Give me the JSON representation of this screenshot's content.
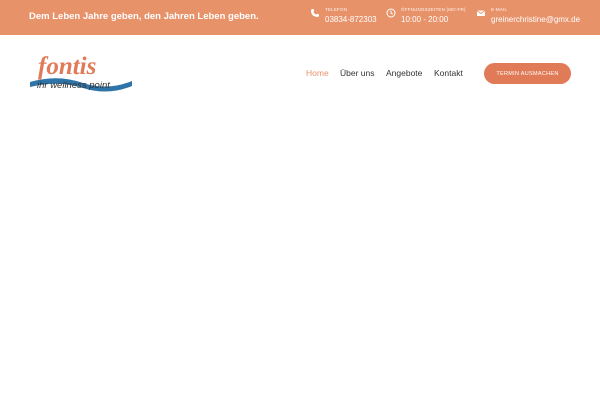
{
  "topbar": {
    "tagline": "Dem Leben Jahre geben, den Jahren Leben geben.",
    "background": "#e8926a",
    "phone": {
      "icon": "phone-icon",
      "label": "TELEFON",
      "value": "03834-872303"
    },
    "hours": {
      "icon": "clock-icon",
      "label": "ÖFFNUNGSZEITEN (MO-FR)",
      "value": "10:00 - 20:00"
    },
    "email": {
      "icon": "mail-icon",
      "label": "E-MAIL",
      "value": "greinerchristine@gmx.de"
    }
  },
  "logo": {
    "wordmark": "fontis",
    "slogan": "ihr wellness point"
  },
  "nav": {
    "items": [
      {
        "label": "Home",
        "active": true
      },
      {
        "label": "Über uns",
        "active": false
      },
      {
        "label": "Angebote",
        "active": false
      },
      {
        "label": "Kontakt",
        "active": false
      }
    ],
    "active_color": "#e8926a"
  },
  "cta": {
    "label": "TERMIN AUSMACHEN",
    "color": "#e07a57"
  }
}
